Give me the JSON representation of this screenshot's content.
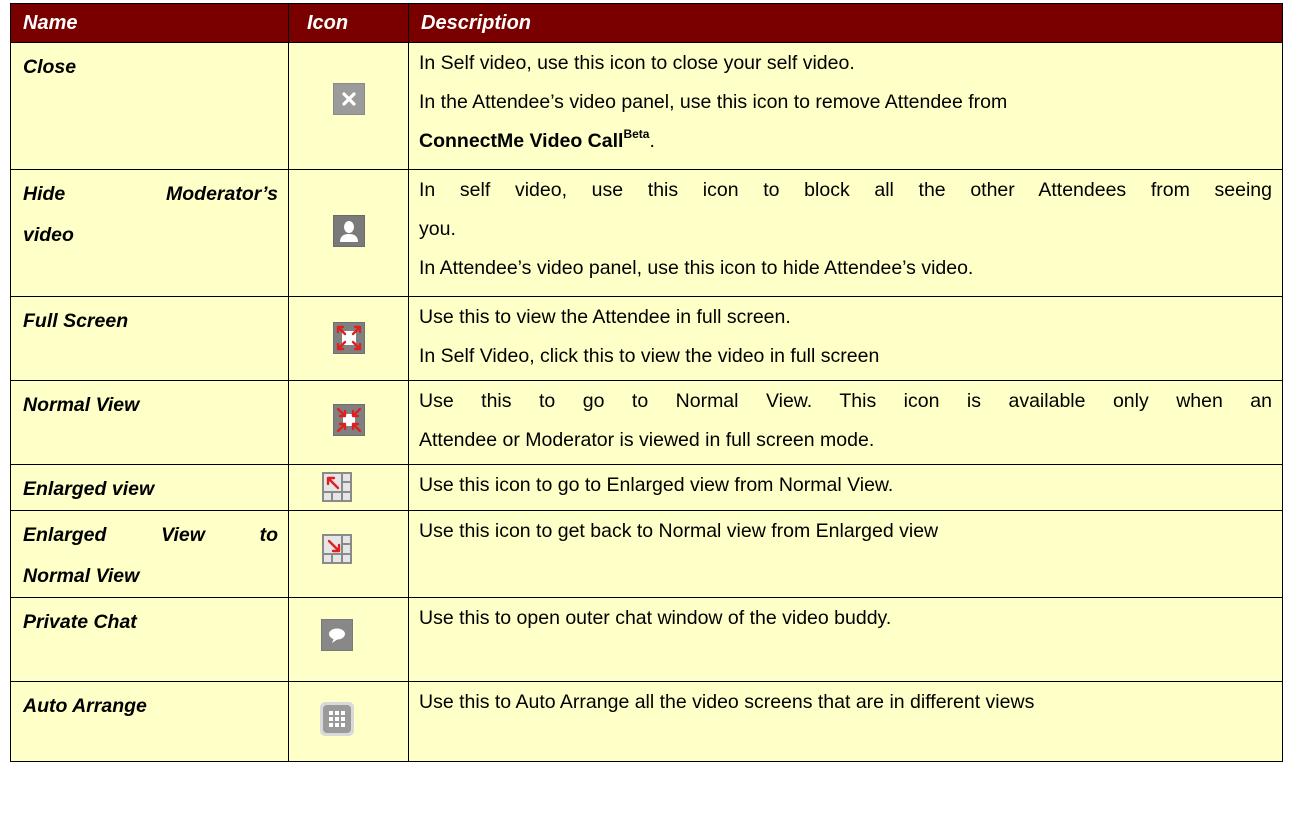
{
  "headers": {
    "name": "Name",
    "icon": "Icon",
    "description": "Description"
  },
  "rows": [
    {
      "name": "Close",
      "icon": "close-icon",
      "desc": [
        "In Self video, use this icon to close your self video.",
        "In the Attendee’s video panel, use this icon to remove Attendee from"
      ],
      "desc_app": "ConnectMe Video Call",
      "desc_app_sup": "Beta",
      "desc_app_end": "."
    },
    {
      "name_lines": [
        "Hide Moderator’s",
        "video"
      ],
      "icon": "person-icon",
      "desc": [
        "In self video, use this icon to block all the other Attendees from seeing",
        "you.",
        "In Attendee’s video panel, use this icon to hide Attendee’s video."
      ]
    },
    {
      "name": "Full Screen",
      "icon": "full-screen-icon",
      "desc": [
        "Use this to view the Attendee in full screen.",
        "In Self Video, click this to view the video in full screen"
      ]
    },
    {
      "name": "Normal View",
      "icon": "normal-view-icon",
      "desc": [
        "Use this to go to Normal View. This icon is available only when an",
        "Attendee or Moderator is viewed in full screen mode."
      ]
    },
    {
      "name": "Enlarged view",
      "icon": "enlarged-view-icon",
      "desc": [
        "Use this icon to go to Enlarged view from Normal View."
      ]
    },
    {
      "name_lines": [
        "Enlarged View to",
        "Normal View"
      ],
      "icon": "enlarged-to-normal-icon",
      "desc": [
        "Use this icon to get back to Normal view from Enlarged view"
      ]
    },
    {
      "name": "Private Chat",
      "icon": "chat-bubble-icon",
      "desc": [
        "Use this to open outer chat window of the video buddy."
      ]
    },
    {
      "name": "Auto Arrange",
      "icon": "grid-icon",
      "desc": [
        "Use this to Auto Arrange all the video screens that are in different views"
      ]
    }
  ],
  "colors": {
    "header_bg": "#7a0000",
    "header_text": "#ffffff",
    "cell_bg": "#ffffc8"
  }
}
